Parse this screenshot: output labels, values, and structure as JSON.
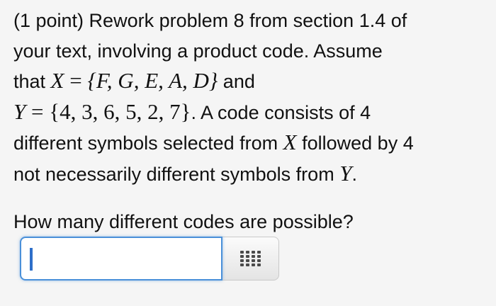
{
  "problem": {
    "line1": "(1 point) Rework problem 8 from section 1.4 of",
    "line2": "your text, involving a product code. Assume",
    "line3_prefix": "that ",
    "set_x_name": "X",
    "equals": " = ",
    "set_x_value": "{F, G, E, A, D}",
    "line3_suffix": " and",
    "set_y_name": "Y",
    "set_y_value": "{4, 3, 6, 5, 2, 7}",
    "line4_suffix": ". A code consists of 4",
    "line5_prefix": "different symbols selected from ",
    "line5_var": "X",
    "line5_suffix": " followed by 4",
    "line6_prefix": "not necessarily different symbols from ",
    "line6_var": "Y",
    "line6_suffix": "."
  },
  "question": {
    "text": "How many different codes are possible?"
  },
  "answer": {
    "value": "",
    "palette_icon": "equation-palette-icon"
  }
}
